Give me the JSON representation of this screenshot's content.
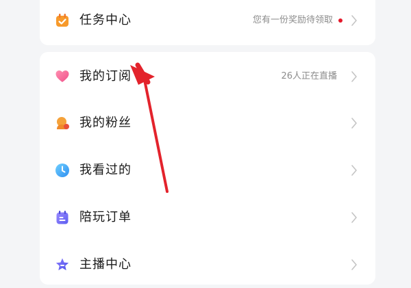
{
  "task_center": {
    "label": "任务中心",
    "right_text": "您有一份奖励待领取",
    "dot_color": "#e4192b"
  },
  "menu": {
    "items": [
      {
        "label": "我的订阅",
        "right_text": "26人正在直播",
        "icon": "heart-icon"
      },
      {
        "label": "我的粉丝",
        "right_text": "",
        "icon": "fan-icon"
      },
      {
        "label": "我看过的",
        "right_text": "",
        "icon": "clock-icon"
      },
      {
        "label": "陪玩订单",
        "right_text": "",
        "icon": "order-icon"
      },
      {
        "label": "主播中心",
        "right_text": "",
        "icon": "star-icon"
      }
    ]
  },
  "colors": {
    "annotation_arrow": "#e3232c",
    "chevron": "#c4c4c4"
  }
}
